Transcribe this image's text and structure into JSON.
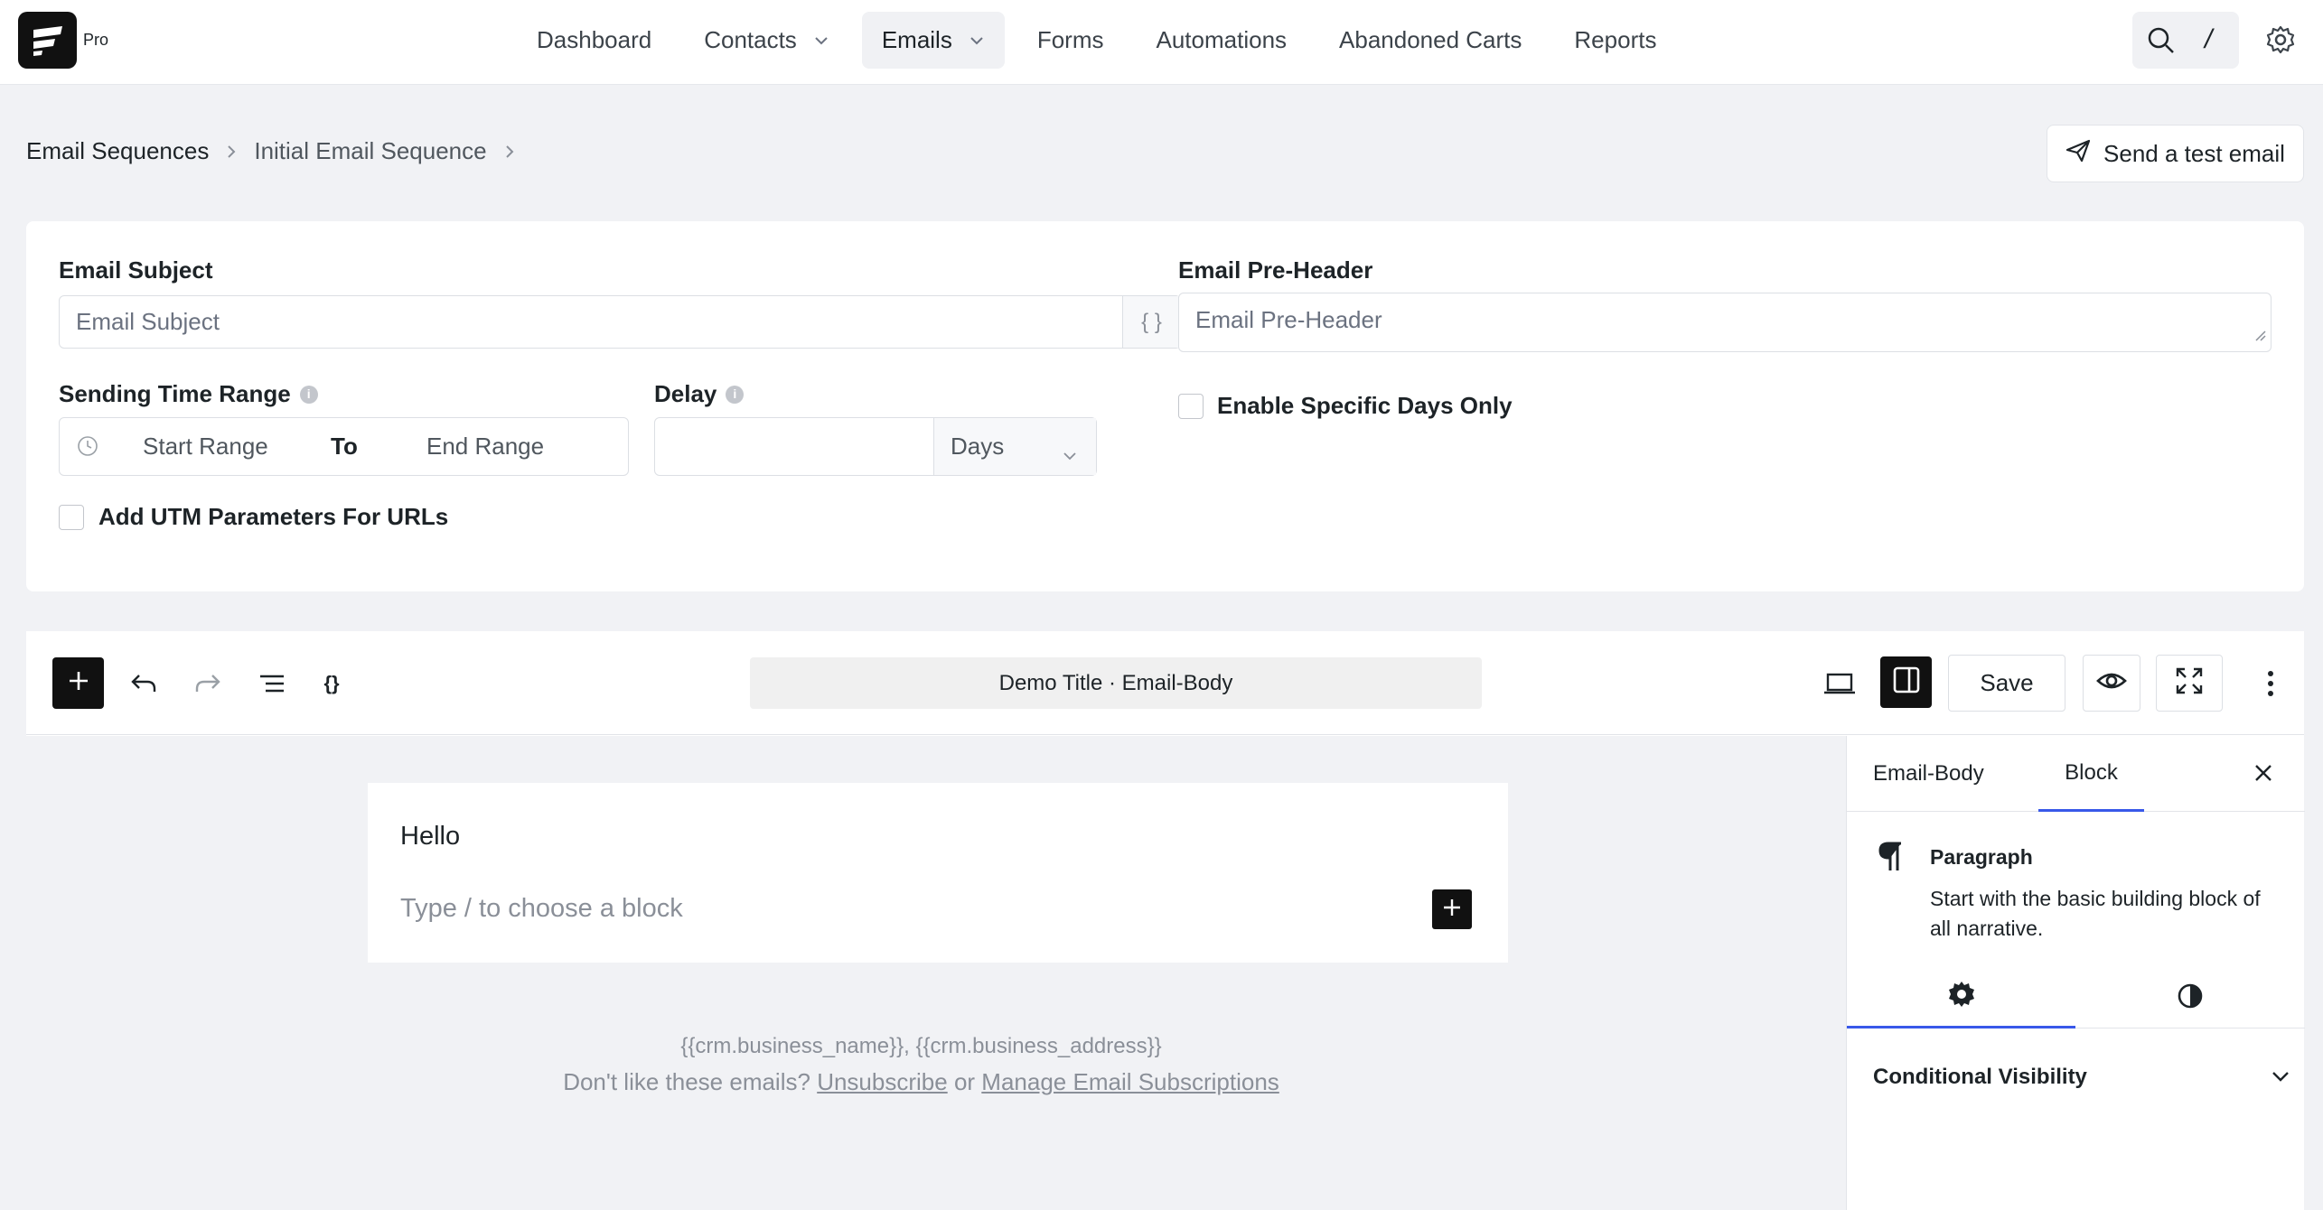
{
  "brand": {
    "logo_icon": "fluentcrm-logo-icon",
    "tier": "Pro"
  },
  "nav": {
    "items": [
      {
        "label": "Dashboard"
      },
      {
        "label": "Contacts"
      },
      {
        "label": "Emails"
      },
      {
        "label": "Forms"
      },
      {
        "label": "Automations"
      },
      {
        "label": "Abandoned Carts"
      },
      {
        "label": "Reports"
      }
    ],
    "search_shortcut": "/"
  },
  "breadcrumb": {
    "root": "Email Sequences",
    "current": "Initial Email Sequence"
  },
  "test_email": {
    "label": "Send a test email"
  },
  "form": {
    "subject": {
      "label": "Email Subject",
      "placeholder": "Email Subject",
      "merge_tag": "{ }"
    },
    "preheader": {
      "label": "Email Pre-Header",
      "placeholder": "Email Pre-Header"
    },
    "time_range": {
      "label": "Sending Time Range",
      "start": "Start Range",
      "to": "To",
      "end": "End Range"
    },
    "delay": {
      "label": "Delay",
      "value": "",
      "unit": "Days"
    },
    "specific_days": {
      "label": "Enable Specific Days Only",
      "checked": false
    },
    "utm": {
      "label": "Add UTM Parameters For URLs",
      "checked": false
    }
  },
  "editor": {
    "doc_title": "Demo Title · Email-Body",
    "save_label": "Save",
    "content": {
      "hello": "Hello",
      "placeholder": "Type / to choose a block"
    },
    "footer": {
      "address": "{{crm.business_name}}, {{crm.business_address}}",
      "prompt": "Don't like these emails?",
      "unsubscribe": "Unsubscribe",
      "or": "or",
      "manage": "Manage Email Subscriptions"
    }
  },
  "sidebar": {
    "tabs": [
      {
        "label": "Email-Body"
      },
      {
        "label": "Block"
      }
    ],
    "block": {
      "name": "Paragraph",
      "description": "Start with the basic building block of all narrative."
    },
    "section": "Conditional Visibility"
  },
  "colors": {
    "accent": "#3858e9",
    "dark": "#111111",
    "background": "#f1f2f5"
  }
}
